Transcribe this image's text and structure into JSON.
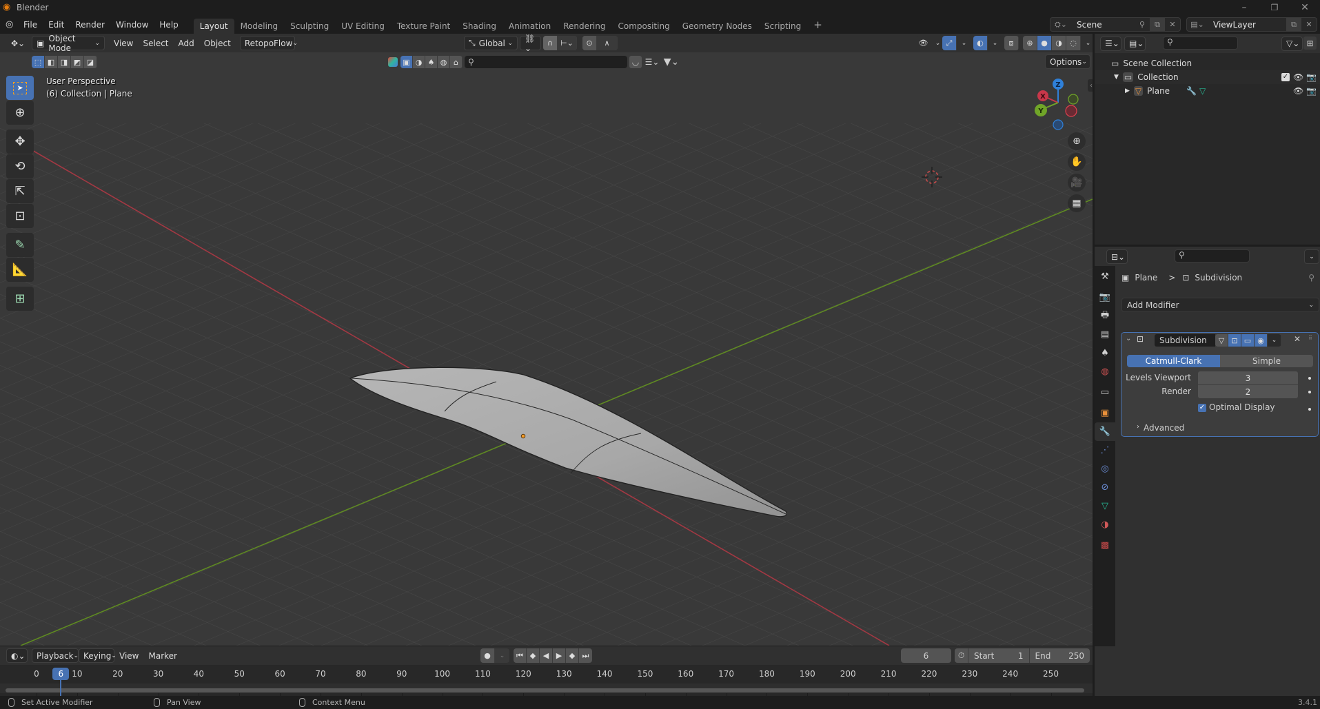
{
  "window": {
    "title": "Blender",
    "controls": {
      "minimize": "–",
      "maximize": "❐",
      "close": "✕"
    }
  },
  "menubar": {
    "menus": [
      "File",
      "Edit",
      "Render",
      "Window",
      "Help"
    ],
    "workspaces": [
      "Layout",
      "Modeling",
      "Sculpting",
      "UV Editing",
      "Texture Paint",
      "Shading",
      "Animation",
      "Rendering",
      "Compositing",
      "Geometry Nodes",
      "Scripting"
    ],
    "active_workspace": "Layout",
    "add_workspace": "+",
    "scene": "Scene",
    "view_layer": "ViewLayer"
  },
  "viewport": {
    "header": {
      "mode": "Object Mode",
      "menus": [
        "View",
        "Select",
        "Add",
        "Object"
      ],
      "addon_menu": "RetopoFlow",
      "orientation": "Global",
      "options_label": "Options"
    },
    "overlay_text": {
      "line1": "User Perspective",
      "line2": "(6) Collection | Plane"
    },
    "gizmo_axes": {
      "z": "Z",
      "x": "X",
      "y": "Y"
    },
    "axis_colors": {
      "x": "#c8374a",
      "y": "#70a528",
      "z": "#2f80d9"
    },
    "object_name": "Plane"
  },
  "toolbar": {
    "tools": [
      "select-box",
      "cursor",
      "move",
      "rotate",
      "scale",
      "transform",
      "annotate",
      "measure",
      "add-cube"
    ],
    "active_tool": "select-box"
  },
  "outliner": {
    "items": [
      {
        "label": "Scene Collection",
        "level": 0
      },
      {
        "label": "Collection",
        "level": 1,
        "checked": true
      },
      {
        "label": "Plane",
        "level": 2
      }
    ]
  },
  "properties": {
    "breadcrumb": {
      "object": "Plane",
      "separator": ">",
      "modifier": "Subdivision"
    },
    "add_modifier_label": "Add Modifier",
    "modifier": {
      "name": "Subdivision",
      "type_options": [
        "Catmull-Clark",
        "Simple"
      ],
      "active_type": "Catmull-Clark",
      "levels_viewport_label": "Levels Viewport",
      "levels_viewport": "3",
      "render_label": "Render",
      "render": "2",
      "optimal_display_label": "Optimal Display",
      "optimal_display": true,
      "advanced_label": "Advanced"
    },
    "tabs": [
      "tool",
      "render",
      "output",
      "view-layer",
      "scene",
      "world",
      "collection",
      "object",
      "modifiers",
      "particles",
      "physics",
      "constraints",
      "data",
      "material",
      "texture"
    ],
    "active_tab": "modifiers",
    "accent": "#4772b3"
  },
  "timeline": {
    "menus": {
      "playback": "Playback",
      "keying": "Keying",
      "view": "View",
      "marker": "Marker"
    },
    "current_frame": "6",
    "start_label": "Start",
    "start": "1",
    "end_label": "End",
    "end": "250",
    "ticks": [
      "0",
      "10",
      "20",
      "30",
      "40",
      "50",
      "60",
      "70",
      "80",
      "90",
      "100",
      "110",
      "120",
      "130",
      "140",
      "150",
      "160",
      "170",
      "180",
      "190",
      "200",
      "210",
      "220",
      "230",
      "240",
      "250"
    ]
  },
  "statusbar": {
    "left": "Set Active Modifier",
    "middle": "Pan View",
    "right": "Context Menu",
    "version": "3.4.1"
  }
}
